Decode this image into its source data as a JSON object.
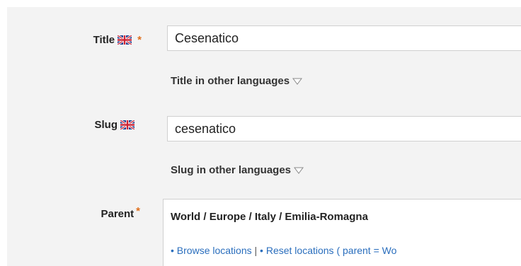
{
  "form": {
    "title": {
      "label": "Title",
      "flag_icon": "uk-flag-icon",
      "required_mark": "*",
      "value": "Cesenatico",
      "other_languages_label": "Title in other languages"
    },
    "slug": {
      "label": "Slug",
      "flag_icon": "uk-flag-icon",
      "value": "cesenatico",
      "other_languages_label": "Slug in other languages"
    },
    "parent": {
      "label": "Parent",
      "required_mark": "*",
      "path": "World / Europe / Italy / Emilia-Romagna",
      "browse_link": "• Browse locations",
      "separator": " | ",
      "reset_link": "• Reset locations ( parent = Wo"
    }
  },
  "colors": {
    "required": "#e0701e",
    "link": "#2a6ebd",
    "panel_background": "#f3f3f3"
  }
}
